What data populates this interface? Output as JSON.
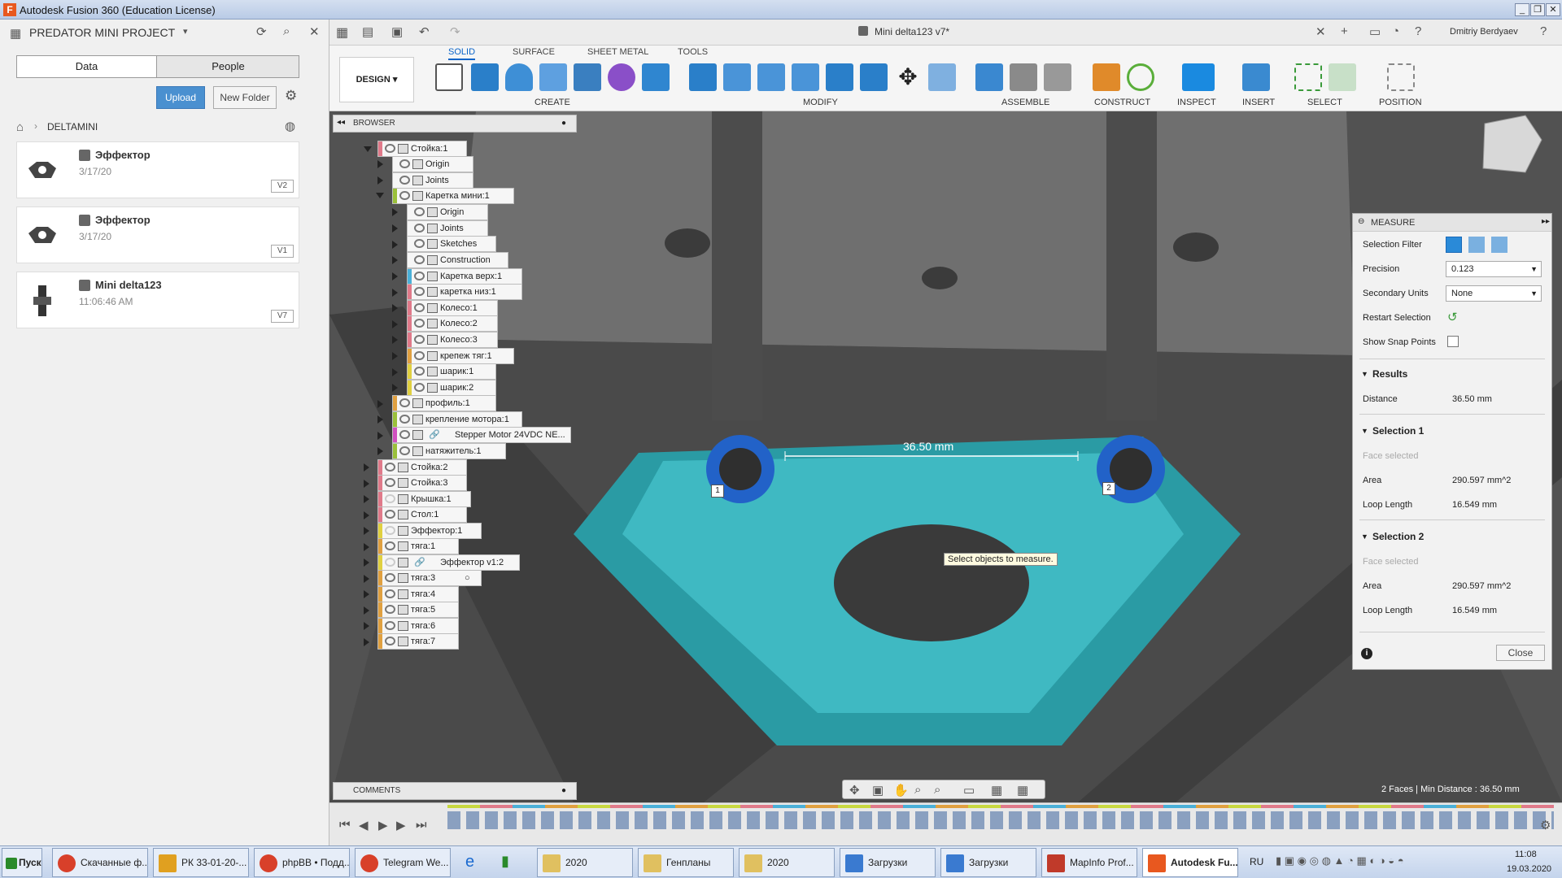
{
  "window": {
    "title": "Autodesk Fusion 360 (Education License)",
    "logo": "F"
  },
  "left": {
    "project": "PREDATOR MINI PROJECT",
    "tabs": [
      "Data",
      "People"
    ],
    "upload": "Upload",
    "new_folder": "New Folder",
    "path": "DELTAMINI",
    "files": [
      {
        "name": "Эффектор",
        "date": "3/17/20",
        "ver": "V2"
      },
      {
        "name": "Эффектор",
        "date": "3/17/20",
        "ver": "V1"
      },
      {
        "name": "Mini delta123",
        "date": "11:06:46 AM",
        "ver": "V7"
      }
    ]
  },
  "doc": {
    "tab": "Mini delta123 v7*",
    "user": "Dmitriy Berdyaev"
  },
  "ribbon": {
    "design": "DESIGN",
    "tabs": [
      "SOLID",
      "SURFACE",
      "SHEET METAL",
      "TOOLS"
    ],
    "groups": [
      "CREATE",
      "MODIFY",
      "ASSEMBLE",
      "CONSTRUCT",
      "INSPECT",
      "INSERT",
      "SELECT",
      "POSITION"
    ]
  },
  "browser": {
    "title": "BROWSER",
    "comments": "COMMENTS",
    "nodes": [
      "Стойка:1",
      "Origin",
      "Joints",
      "Каретка мини:1",
      "Origin",
      "Joints",
      "Sketches",
      "Construction",
      "Каретка верх:1",
      "каретка низ:1",
      "Колесо:1",
      "Колесо:2",
      "Колесо:3",
      "крепеж тяг:1",
      "шарик:1",
      "шарик:2",
      "профиль:1",
      "крепление мотора:1",
      "Stepper Motor 24VDC NE...",
      "натяжитель:1",
      "Стойка:2",
      "Стойка:3",
      "Крышка:1",
      "Стол:1",
      "Эффектор:1",
      "тяга:1",
      "Эффектор v1:2",
      "тяга:3",
      "тяга:4",
      "тяга:5",
      "тяга:6",
      "тяга:7"
    ]
  },
  "viewport": {
    "dimension": "36.50 mm",
    "tooltip": "Select objects to measure.",
    "marker1": "1",
    "marker2": "2",
    "status": "2 Faces | Min Distance : 36.50 mm"
  },
  "measure": {
    "title": "MEASURE",
    "selection_filter": "Selection Filter",
    "precision": "Precision",
    "precision_val": "0.123",
    "secondary": "Secondary Units",
    "secondary_val": "None",
    "restart": "Restart Selection",
    "snap": "Show Snap Points",
    "results": "Results",
    "distance": "Distance",
    "distance_val": "36.50 mm",
    "sel1": "Selection 1",
    "sel2": "Selection 2",
    "face": "Face selected",
    "area": "Area",
    "area_val": "290.597 mm^2",
    "loop": "Loop Length",
    "loop_val": "16.549 mm",
    "close": "Close"
  },
  "taskbar": {
    "start": "Пуск",
    "items": [
      "Скачанные ф...",
      "РК 33-01-20-...",
      "phpBB • Подд...",
      "Telegram We...",
      "2020",
      "Генпланы",
      "2020",
      "Загрузки",
      "Загрузки",
      "MapInfo Prof...",
      "Autodesk Fu..."
    ],
    "lang": "RU",
    "time": "11:08",
    "date": "19.03.2020"
  }
}
